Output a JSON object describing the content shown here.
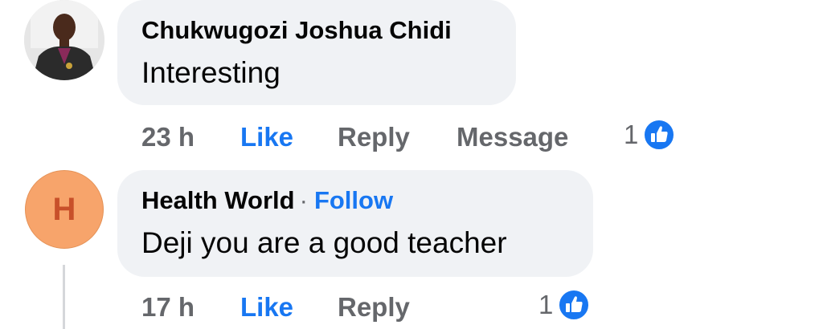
{
  "comments": [
    {
      "author": "Chukwugozi Joshua Chidi",
      "text": "Interesting",
      "time": "23 h",
      "like_label": "Like",
      "reply_label": "Reply",
      "message_label": "Message",
      "reaction_count": "1",
      "reaction_icon": "like-reaction-icon"
    },
    {
      "author": "Health World",
      "separator": "·",
      "follow_label": "Follow",
      "avatar_letter": "H",
      "text": "Deji you are a good teacher",
      "time": "17 h",
      "like_label": "Like",
      "reply_label": "Reply",
      "reaction_count": "1",
      "reaction_icon": "like-reaction-icon"
    }
  ],
  "colors": {
    "accent": "#1877f2",
    "bubble": "#f0f2f5",
    "meta_grey": "#65676b",
    "avatar_orange": "#f7a46b"
  }
}
